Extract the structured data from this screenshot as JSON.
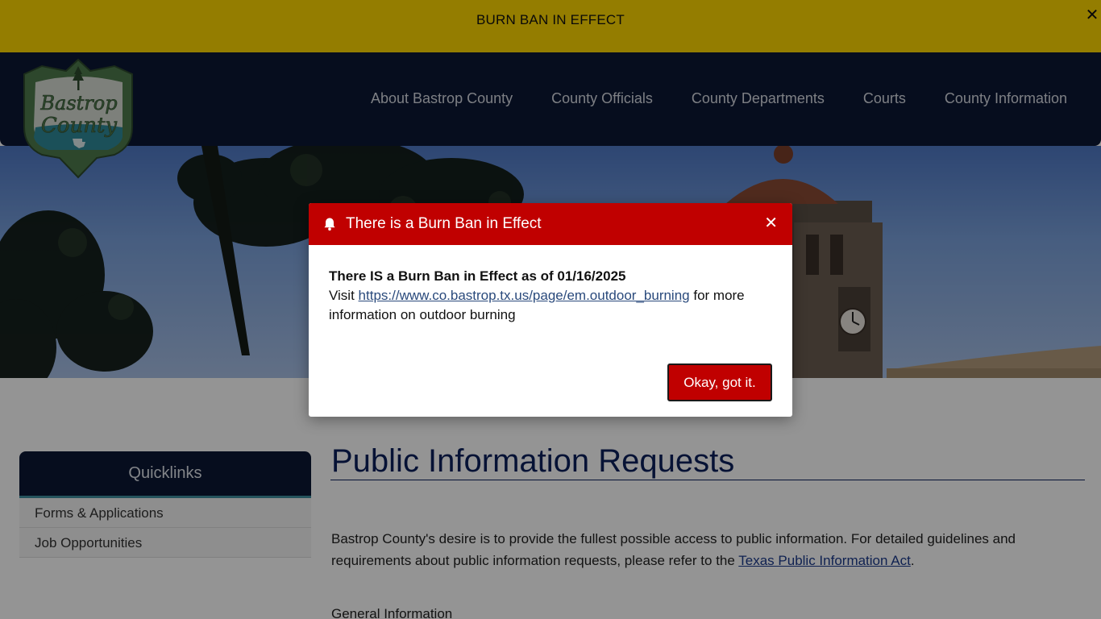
{
  "alert": {
    "text": "BURN BAN IN EFFECT",
    "close_glyph": "✕"
  },
  "logo": {
    "line1": "Bastrop",
    "line2": "County"
  },
  "nav": {
    "items": [
      {
        "label": "About Bastrop County"
      },
      {
        "label": "County Officials"
      },
      {
        "label": "County Departments"
      },
      {
        "label": "Courts"
      },
      {
        "label": "County Information"
      }
    ]
  },
  "quicklinks": {
    "title": "Quicklinks",
    "items": [
      {
        "label": "Forms & Applications"
      },
      {
        "label": "Job Opportunities"
      }
    ]
  },
  "main": {
    "title": "Public Information Requests",
    "intro_text": "Bastrop County's desire is to provide the fullest possible access to public information.  For detailed guidelines and requirements about public information requests, please refer to the ",
    "intro_link": "Texas Public Information Act",
    "intro_end": ".",
    "subheading": "General Information"
  },
  "modal": {
    "title": "There is a Burn Ban in Effect",
    "close_glyph": "✕",
    "heading": "There IS a Burn Ban in Effect as of 01/16/2025",
    "visit_prefix": "Visit ",
    "link": "https://www.co.bastrop.tx.us/page/em.outdoor_burning",
    "visit_suffix": " for more information on outdoor burning",
    "ok_label": "Okay, got it."
  },
  "colors": {
    "alert_bar": "#ffd700",
    "header": "#0b1735",
    "modal_header": "#c00000",
    "title": "#0b1f5c"
  }
}
